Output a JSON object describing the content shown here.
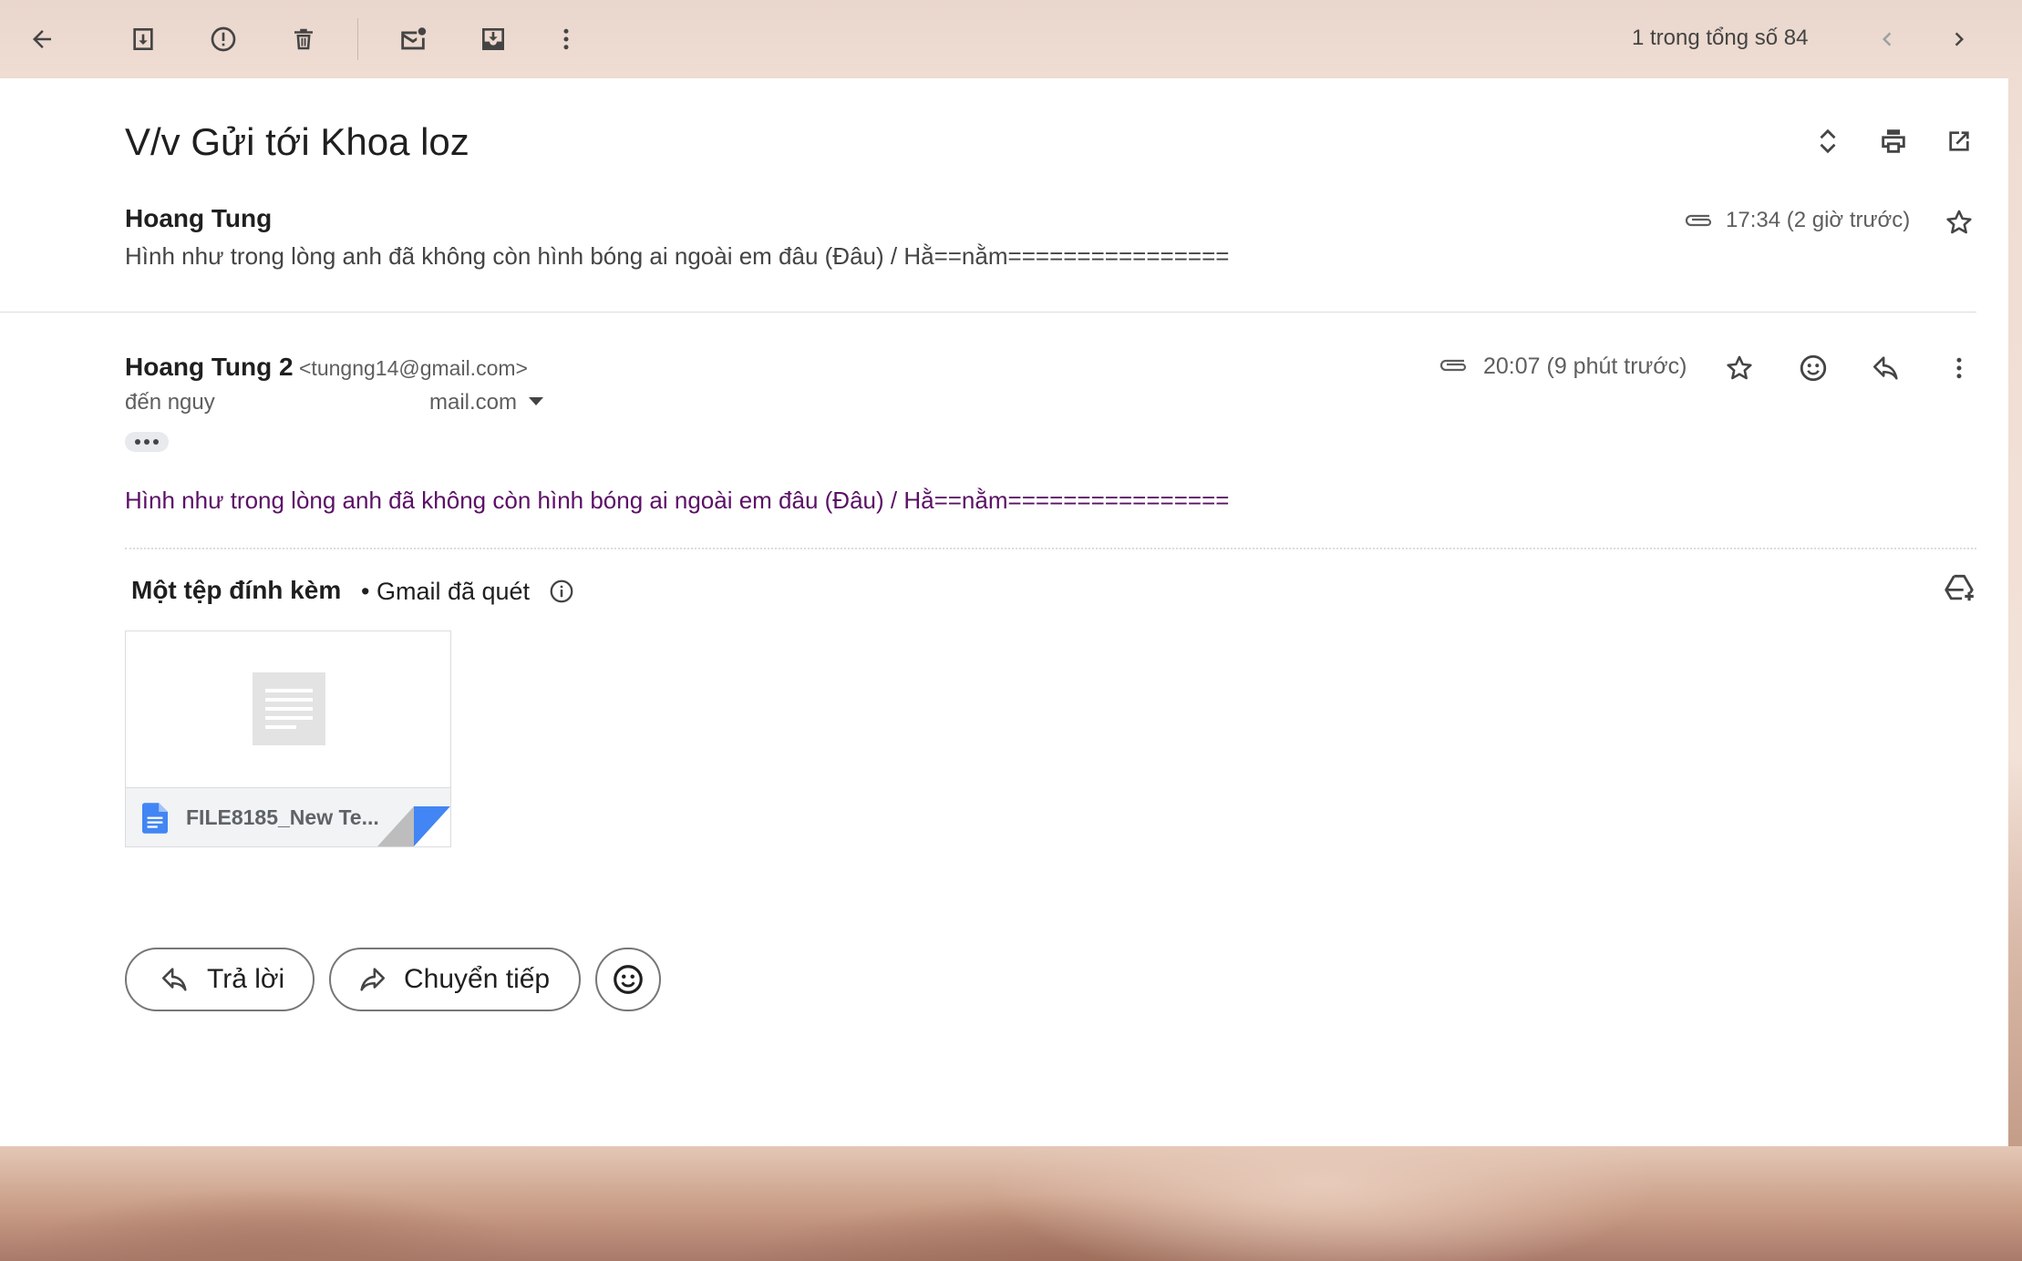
{
  "toolbar": {
    "icons": [
      "back-arrow-icon",
      "archive-icon",
      "report-spam-icon",
      "delete-icon",
      "mark-unread-icon",
      "move-to-icon",
      "more-vert-icon"
    ],
    "pager_text": "1 trong tổng số 84",
    "prev_icon": "chevron-left-icon",
    "next_icon": "chevron-right-icon"
  },
  "thread": {
    "subject": "V/v Gửi tới Khoa loz",
    "header_icons": [
      "expand-collapse-icon",
      "print-icon",
      "open-new-window-icon"
    ]
  },
  "message1": {
    "sender": "Hoang Tung",
    "snippet": "Hình như trong lòng anh đã không còn hình bóng ai ngoài em đâu (Đâu) / Hằ==nằm================",
    "time": "17:34 (2 giờ trước)",
    "has_attachment": true
  },
  "message2": {
    "sender_name": "Hoang Tung 2",
    "sender_email": "<tungng14@gmail.com>",
    "to_prefix": "đến nguy",
    "to_suffix": "mail.com",
    "time": "20:07 (9 phút trước)",
    "body": "Hình như trong lòng anh đã không còn hình bóng ai ngoài em đâu (Đâu) / Hằ==nằm================",
    "action_icons": [
      "star-icon",
      "emoji-icon",
      "reply-icon",
      "more-vert-icon"
    ]
  },
  "attachments": {
    "title": "Một tệp đính kèm",
    "scan_text": "• Gmail đã quét",
    "file_name": "FILE8185_New Te...",
    "file_icon": "google-docs-icon",
    "add_to_drive_icon": "add-to-drive-icon"
  },
  "actions": {
    "reply_label": "Trả lời",
    "forward_label": "Chuyển tiếp",
    "emoji_icon": "emoji-icon"
  },
  "colors": {
    "panel_bg": "#ffffff",
    "body_text": "#5b1066",
    "docs_blue": "#4285f4",
    "muted": "#5e5e5e"
  }
}
